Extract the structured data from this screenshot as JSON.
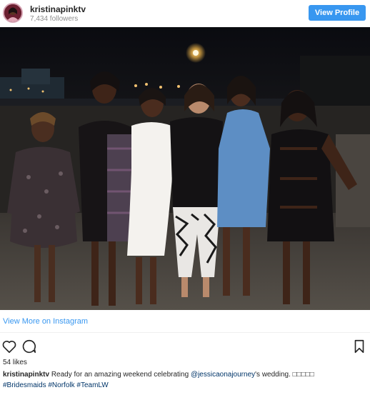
{
  "account": {
    "username": "kristinapinktv",
    "followers": "7,434 followers"
  },
  "header": {
    "view_profile_label": "View Profile"
  },
  "photo": {
    "description_alt": "Group photo"
  },
  "links": {
    "view_more": "View More on Instagram"
  },
  "actions": {
    "like_icon": "heart-icon",
    "comment_icon": "comment-icon",
    "save_icon": "bookmark-icon"
  },
  "stats": {
    "likes": "54 likes"
  },
  "caption": {
    "username": "kristinapinktv",
    "text_before": "Ready for an amazing weekend celebrating",
    "mention": "@jessicaonajourney",
    "text_after": "'s wedding. □□□□□",
    "hashtags": [
      "#Bridesmaids",
      "#Norfolk",
      "#TeamLW"
    ]
  },
  "colors": {
    "accent": "#3897f0",
    "hashtag": "#003569",
    "muted": "#8e8e8e"
  }
}
